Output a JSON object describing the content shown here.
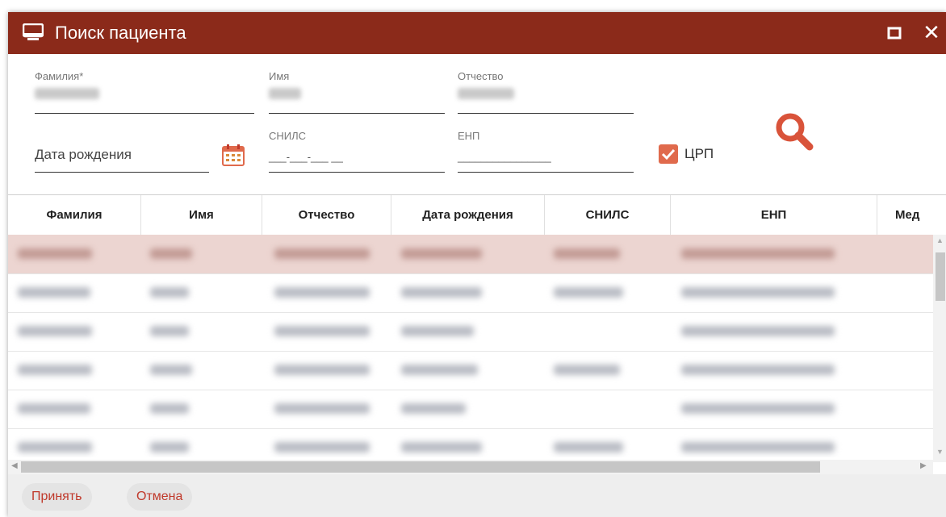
{
  "window": {
    "title": "Поиск пациента",
    "icons": [
      "monitor-icon",
      "maximize-icon",
      "close-icon"
    ],
    "close_glyph": "✕",
    "accent_color": "#8b2a1a"
  },
  "form": {
    "surname_label": "Фамилия*",
    "name_label": "Имя",
    "patronymic_label": "Отчество",
    "birthdate_placeholder": "Дата рождения",
    "snils_label": "СНИЛС",
    "snils_mask": "___-___-___ __",
    "enp_label": "ЕНП",
    "enp_mask": "________________",
    "crp_label": "ЦРП",
    "crp_checked": true,
    "check_color": "#e06a4c"
  },
  "grid": {
    "columns": [
      "Фамилия",
      "Имя",
      "Отчество",
      "Дата рождения",
      "СНИЛС",
      "ЕНП",
      "Мед"
    ],
    "selected_row_color": "#ecd5d1"
  },
  "footer": {
    "accept_label": "Принять",
    "cancel_label": "Отмена"
  }
}
